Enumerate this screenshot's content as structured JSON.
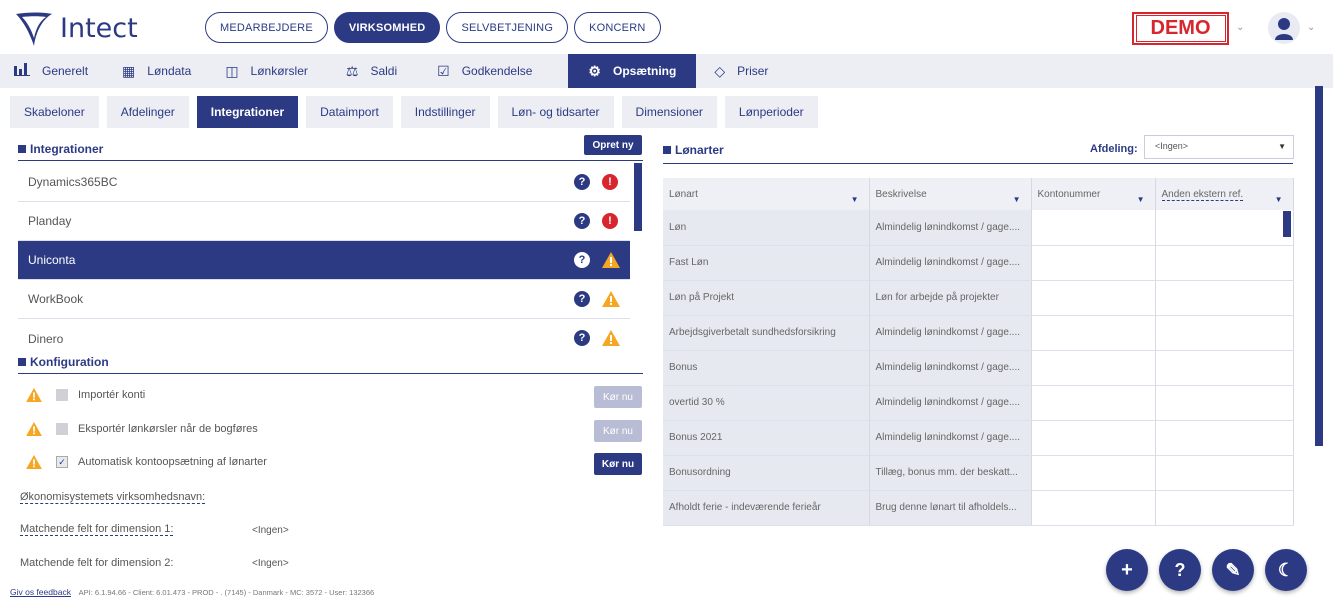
{
  "brand": {
    "name": "Intect"
  },
  "top_nav": [
    "MEDARBEJDERE",
    "VIRKSOMHED",
    "SELVBETJENING",
    "KONCERN"
  ],
  "demo_label": "DEMO",
  "main_nav": [
    {
      "label": "Generelt",
      "icon": "chart-icon"
    },
    {
      "label": "Løndata",
      "icon": "grid-icon"
    },
    {
      "label": "Lønkørsler",
      "icon": "window-icon"
    },
    {
      "label": "Saldi",
      "icon": "scale-icon"
    },
    {
      "label": "Godkendelse",
      "icon": "calendar-check-icon"
    },
    {
      "label": "Opsætning",
      "icon": "gear-icon"
    },
    {
      "label": "Priser",
      "icon": "diamond-icon"
    }
  ],
  "sub_tabs": [
    "Skabeloner",
    "Afdelinger",
    "Integrationer",
    "Dataimport",
    "Indstillinger",
    "Løn- og tidsarter",
    "Dimensioner",
    "Lønperioder"
  ],
  "integrations": {
    "title": "Integrationer",
    "create_button": "Opret ny",
    "items": [
      {
        "name": "Dynamics365BC",
        "status": "error"
      },
      {
        "name": "Planday",
        "status": "error"
      },
      {
        "name": "Uniconta",
        "status": "warning"
      },
      {
        "name": "WorkBook",
        "status": "warning"
      },
      {
        "name": "Dinero",
        "status": "warning"
      }
    ]
  },
  "config": {
    "title": "Konfiguration",
    "rows": [
      {
        "label": "Importér konti",
        "checked": false,
        "button": "Kør nu",
        "enabled": false
      },
      {
        "label": "Eksportér lønkørsler når de bogføres",
        "checked": false,
        "button": "Kør nu",
        "enabled": false
      },
      {
        "label": "Automatisk kontoopsætning af lønarter",
        "checked": true,
        "button": "Kør nu",
        "enabled": true
      }
    ],
    "company_name_label": "Økonomisystemets virksomhedsnavn:",
    "dim1_label": "Matchende felt for dimension 1:",
    "dim1_value": "<Ingen>",
    "dim2_label": "Matchende felt for dimension 2:",
    "dim2_value": "<Ingen>"
  },
  "lonarter": {
    "title": "Lønarter",
    "afdeling_label": "Afdeling:",
    "afdeling_value": "<Ingen>",
    "columns": [
      "Lønart",
      "Beskrivelse",
      "Kontonummer",
      "Anden ekstern ref."
    ],
    "rows": [
      [
        "Løn",
        "Almindelig lønindkomst / gage....",
        "",
        ""
      ],
      [
        "Fast Løn",
        "Almindelig lønindkomst / gage....",
        "",
        ""
      ],
      [
        "Løn på Projekt",
        "Løn for arbejde på projekter",
        "",
        ""
      ],
      [
        "Arbejdsgiverbetalt sundhedsforsikring",
        "Almindelig lønindkomst / gage....",
        "",
        ""
      ],
      [
        "Bonus",
        "Almindelig lønindkomst / gage....",
        "",
        ""
      ],
      [
        "overtid 30 %",
        "Almindelig lønindkomst / gage....",
        "",
        ""
      ],
      [
        "Bonus 2021",
        "Almindelig lønindkomst / gage....",
        "",
        ""
      ],
      [
        "Bonusordning",
        "Tillæg, bonus mm. der beskatt...",
        "",
        ""
      ],
      [
        "Afholdt ferie - indeværende ferieår",
        "Brug denne lønart til afholdels...",
        "",
        ""
      ]
    ]
  },
  "footer": {
    "feedback": "Giv os feedback",
    "info": "API: 6.1.94.66 - Client: 6.01.473 - PROD - . (7145) - Danmark - MC: 3572 - User: 132366"
  },
  "fabs": [
    "+",
    "?",
    "✎",
    "☾"
  ]
}
